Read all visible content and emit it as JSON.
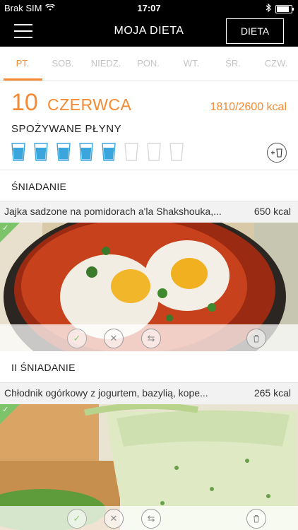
{
  "status": {
    "carrier": "Brak SIM",
    "time": "17:07"
  },
  "nav": {
    "title": "MOJA DIETA",
    "diet_button": "DIETA"
  },
  "tabs": [
    "PT.",
    "SOB.",
    "NIEDZ.",
    "PON.",
    "WT.",
    "ŚR.",
    "CZW."
  ],
  "date": {
    "day": "10",
    "month": "CZERWCA",
    "kcal": "1810/2600 kcal"
  },
  "fluids": {
    "title": "SPOŻYWANE PŁYNY",
    "filled": 5,
    "total": 8,
    "add_icon": "add-drink-icon",
    "fill_color": "#3aa6dd"
  },
  "meals": [
    {
      "title": "ŚNIADANIE",
      "dish": "Jajka sadzone na pomidorach a'la Shakshouka,...",
      "kcal": "650 kcal",
      "eaten": true
    },
    {
      "title": "II ŚNIADANIE",
      "dish": "Chłodnik ogórkowy z jogurtem, bazylią, kope...",
      "kcal": "265 kcal",
      "eaten": true
    }
  ],
  "colors": {
    "accent": "#f58a32",
    "check": "#7cc36a"
  }
}
